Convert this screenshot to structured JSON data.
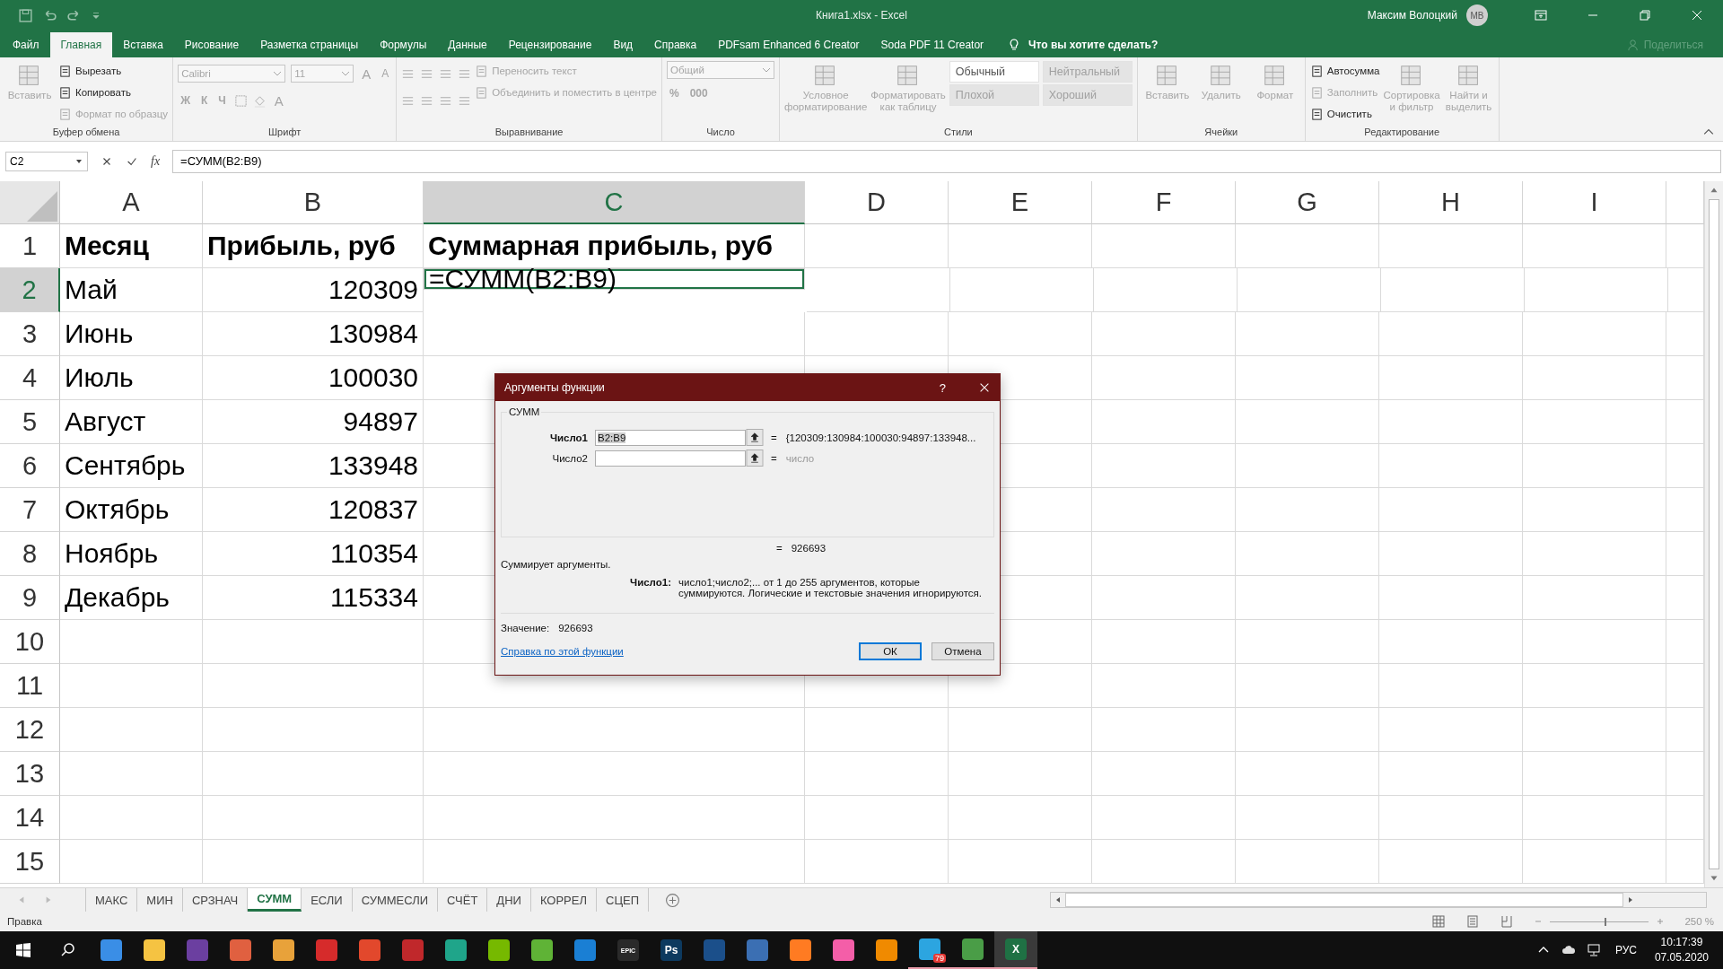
{
  "window": {
    "title": "Книга1.xlsx  -  Excel",
    "user": "Максим Волоцкий",
    "avatar_initials": "MB"
  },
  "ribbon_tabs": [
    {
      "label": "Файл",
      "selected": false
    },
    {
      "label": "Главная",
      "selected": true
    },
    {
      "label": "Вставка",
      "selected": false
    },
    {
      "label": "Рисование",
      "selected": false
    },
    {
      "label": "Разметка страницы",
      "selected": false
    },
    {
      "label": "Формулы",
      "selected": false
    },
    {
      "label": "Данные",
      "selected": false
    },
    {
      "label": "Рецензирование",
      "selected": false
    },
    {
      "label": "Вид",
      "selected": false
    },
    {
      "label": "Справка",
      "selected": false
    },
    {
      "label": "PDFsam Enhanced 6 Creator",
      "selected": false
    },
    {
      "label": "Soda PDF 11 Creator",
      "selected": false
    }
  ],
  "tell_me": "Что вы хотите сделать?",
  "share": {
    "label": "Поделиться",
    "disabled": true
  },
  "ribbon_groups": [
    {
      "label": "Буфер обмена",
      "columns": [
        [
          {
            "kind": "large",
            "label": "Вставить",
            "disabled": true
          }
        ],
        [
          {
            "kind": "small",
            "label": "Вырезать",
            "disabled": false
          },
          {
            "kind": "small",
            "label": "Копировать",
            "disabled": false
          },
          {
            "kind": "small",
            "label": "Формат по образцу",
            "disabled": true
          }
        ]
      ]
    },
    {
      "label": "Шрифт",
      "columns": [
        [
          {
            "kind": "fieldrow",
            "fields": [
              "Calibri",
              "11"
            ],
            "glyphs": [
              "A",
              "A"
            ],
            "disabled": true
          },
          {
            "kind": "glyphs",
            "glyphs": [
              "Ж",
              "К",
              "Ч"
            ],
            "tail": "A",
            "disabled": true
          }
        ]
      ]
    },
    {
      "label": "Выравнивание",
      "columns": [
        [
          {
            "kind": "icons",
            "disabled": true
          },
          {
            "kind": "icons",
            "disabled": true
          }
        ],
        [
          {
            "kind": "small",
            "label": "Переносить текст",
            "disabled": true
          },
          {
            "kind": "small",
            "label": "Объединить и поместить в центре",
            "disabled": true
          }
        ]
      ]
    },
    {
      "label": "Число",
      "columns": [
        [
          {
            "kind": "field",
            "value": "Общий",
            "disabled": true
          },
          {
            "kind": "glyphs",
            "glyphs": [
              "%",
              "000"
            ],
            "disabled": true
          }
        ]
      ]
    },
    {
      "label": "Стили",
      "columns": [
        [
          {
            "kind": "large",
            "label": "Условное форматирование",
            "disabled": true
          }
        ],
        [
          {
            "kind": "large",
            "label": "Форматировать как таблицу",
            "disabled": true
          }
        ],
        [
          {
            "kind": "style",
            "label": "Обычный",
            "disabled": false
          },
          {
            "kind": "style",
            "label": "Плохой",
            "disabled": true
          }
        ],
        [
          {
            "kind": "style",
            "label": "Нейтральный",
            "disabled": true
          },
          {
            "kind": "style",
            "label": "Хороший",
            "disabled": true
          }
        ]
      ]
    },
    {
      "label": "Ячейки",
      "columns": [
        [
          {
            "kind": "large",
            "label": "Вставить",
            "disabled": true
          }
        ],
        [
          {
            "kind": "large",
            "label": "Удалить",
            "disabled": true
          }
        ],
        [
          {
            "kind": "large",
            "label": "Формат",
            "disabled": true
          }
        ]
      ]
    },
    {
      "label": "Редактирование",
      "columns": [
        [
          {
            "kind": "small",
            "label": "Автосумма",
            "disabled": false
          },
          {
            "kind": "small",
            "label": "Заполнить",
            "disabled": true
          },
          {
            "kind": "small",
            "label": "Очистить",
            "disabled": false
          }
        ],
        [
          {
            "kind": "large",
            "label": "Сортировка и фильтр",
            "disabled": true
          }
        ],
        [
          {
            "kind": "large",
            "label": "Найти и выделить",
            "disabled": true
          }
        ]
      ]
    }
  ],
  "formula_bar": {
    "name_box": "C2",
    "fx": "fx",
    "formula": "=СУММ(B2:B9)"
  },
  "columns": [
    {
      "letter": "A",
      "selected": false
    },
    {
      "letter": "B",
      "selected": false
    },
    {
      "letter": "C",
      "selected": true
    },
    {
      "letter": "D",
      "selected": false
    },
    {
      "letter": "E",
      "selected": false
    },
    {
      "letter": "F",
      "selected": false
    },
    {
      "letter": "G",
      "selected": false
    },
    {
      "letter": "H",
      "selected": false
    },
    {
      "letter": "I",
      "selected": false
    }
  ],
  "rows": [
    {
      "number": "1",
      "selected": false,
      "cells": [
        {
          "kind": "header",
          "text": "Месяц"
        },
        {
          "kind": "header",
          "text": "Прибыль, руб"
        },
        {
          "kind": "header",
          "text": "Суммарная прибыль, руб"
        }
      ]
    },
    {
      "number": "2",
      "selected": true,
      "cells": [
        {
          "kind": "text",
          "text": "Май"
        },
        {
          "kind": "number",
          "text": "120309"
        },
        {
          "kind": "formula",
          "text": "=СУММ(B2:B9)"
        }
      ]
    },
    {
      "number": "3",
      "selected": false,
      "cells": [
        {
          "kind": "text",
          "text": "Июнь"
        },
        {
          "kind": "number",
          "text": "130984"
        }
      ]
    },
    {
      "number": "4",
      "selected": false,
      "cells": [
        {
          "kind": "text",
          "text": "Июль"
        },
        {
          "kind": "number",
          "text": "100030"
        }
      ]
    },
    {
      "number": "5",
      "selected": false,
      "cells": [
        {
          "kind": "text",
          "text": "Август"
        },
        {
          "kind": "number",
          "text": "94897"
        }
      ]
    },
    {
      "number": "6",
      "selected": false,
      "cells": [
        {
          "kind": "text",
          "text": "Сентябрь"
        },
        {
          "kind": "number",
          "text": "133948"
        }
      ]
    },
    {
      "number": "7",
      "selected": false,
      "cells": [
        {
          "kind": "text",
          "text": "Октябрь"
        },
        {
          "kind": "number",
          "text": "120837"
        }
      ]
    },
    {
      "number": "8",
      "selected": false,
      "cells": [
        {
          "kind": "text",
          "text": "Ноябрь"
        },
        {
          "kind": "number",
          "text": "110354"
        }
      ]
    },
    {
      "number": "9",
      "selected": false,
      "cells": [
        {
          "kind": "text",
          "text": "Декабрь"
        },
        {
          "kind": "number",
          "text": "115334"
        }
      ]
    },
    {
      "number": "10",
      "selected": false
    },
    {
      "number": "11",
      "selected": false
    },
    {
      "number": "12",
      "selected": false
    },
    {
      "number": "13",
      "selected": false
    },
    {
      "number": "14",
      "selected": false
    },
    {
      "number": "15",
      "selected": false
    }
  ],
  "dialog": {
    "title": "Аргументы функции",
    "help_glyph": "?",
    "function": "СУММ",
    "arguments": [
      {
        "label": "Число1",
        "value": "B2:B9",
        "equals": "=",
        "result": "{120309:130984:100030:94897:133948...",
        "active": true
      },
      {
        "label": "Число2",
        "equals": "=",
        "result": "число",
        "active": false
      }
    ],
    "total_equals": "=",
    "total": "926693",
    "description": "Суммирует аргументы.",
    "arg_help_label": "Число1:",
    "arg_help": "число1;число2;... от 1 до 255 аргументов, которые суммируются. Логические и текстовые значения игнорируются.",
    "value_label": "Значение:",
    "value": "926693",
    "help_link": "Справка по этой функции",
    "buttons": [
      {
        "label": "ОК",
        "default": true
      },
      {
        "label": "Отмена",
        "default": false
      }
    ]
  },
  "sheet_tabs": [
    {
      "label": "МАКС",
      "selected": false
    },
    {
      "label": "МИН",
      "selected": false
    },
    {
      "label": "СРЗНАЧ",
      "selected": false
    },
    {
      "label": "СУММ",
      "selected": true
    },
    {
      "label": "ЕСЛИ",
      "selected": false
    },
    {
      "label": "СУММЕСЛИ",
      "selected": false
    },
    {
      "label": "СЧЁТ",
      "selected": false
    },
    {
      "label": "ДНИ",
      "selected": false
    },
    {
      "label": "КОРРЕЛ",
      "selected": false
    },
    {
      "label": "СЦЕП",
      "selected": false
    }
  ],
  "status_bar": {
    "mode": "Правка",
    "zoom": {
      "level": 0.55,
      "reading": "250 %"
    }
  },
  "taskbar": {
    "apps": [
      {
        "color": "#3a8ee6",
        "running": false,
        "active": false
      },
      {
        "color": "#f5c342",
        "running": false,
        "active": false
      },
      {
        "color": "#6b3fa0",
        "running": false,
        "active": false
      },
      {
        "color": "#e06040",
        "running": false,
        "active": false
      },
      {
        "color": "#e8a23a",
        "running": false,
        "active": false
      },
      {
        "color": "#d62b2b",
        "running": false,
        "active": false
      },
      {
        "color": "#e2482c",
        "running": false,
        "active": false
      },
      {
        "color": "#c0282b",
        "running": false,
        "active": false
      },
      {
        "color": "#1fa58a",
        "running": false,
        "active": false
      },
      {
        "color": "#76b900",
        "running": false,
        "active": false
      },
      {
        "color": "#5fb336",
        "running": false,
        "active": false
      },
      {
        "color": "#1a7fd4",
        "running": false,
        "active": false
      },
      {
        "color": "#2a2a2a",
        "glyph": "EPIC",
        "running": false,
        "active": false
      },
      {
        "color": "#0d3a5f",
        "glyph": "Ps",
        "running": false,
        "active": false
      },
      {
        "color": "#1b4f8a",
        "running": false,
        "active": false
      },
      {
        "color": "#3b6fb3",
        "running": false,
        "active": false
      },
      {
        "color": "#ff7b22",
        "running": false,
        "active": false
      },
      {
        "color": "#f45ea8",
        "running": false,
        "active": false
      },
      {
        "color": "#f08a00",
        "running": false,
        "active": false
      },
      {
        "color": "#2ca5e0",
        "badge": "79",
        "running": true,
        "active": false
      },
      {
        "color": "#4a9d47",
        "running": true,
        "active": false
      },
      {
        "color": "#1f7144",
        "glyph": "X",
        "running": true,
        "active": true
      }
    ],
    "language": "РУС",
    "time": "10:17:39",
    "date": "07.05.2020"
  }
}
